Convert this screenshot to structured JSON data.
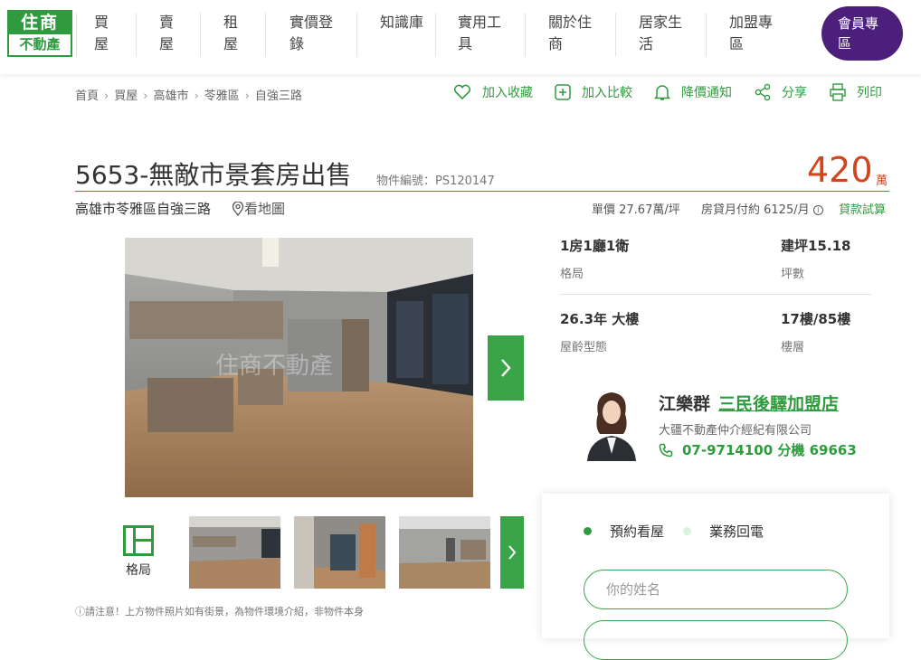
{
  "brand": {
    "logo_top": "住商",
    "logo_bottom": "不動產",
    "color": "#2f9b3e"
  },
  "nav": {
    "items": [
      "買屋",
      "賣屋",
      "租屋",
      "實價登錄",
      "知識庫",
      "實用工具",
      "關於住商",
      "居家生活",
      "加盟專區"
    ],
    "member": "會員專區"
  },
  "breadcrumb": [
    "首頁",
    "買屋",
    "高雄市",
    "苓雅區",
    "自強三路"
  ],
  "actions": {
    "favorite": "加入收藏",
    "compare": "加入比較",
    "notify": "降價通知",
    "share": "分享",
    "print": "列印"
  },
  "listing": {
    "title": "5653-無敵市景套房出售",
    "object_no": "物件編號：PS120147",
    "price": "420",
    "price_unit": "萬",
    "address": "高雄市苓雅區自強三路",
    "map_link": "看地圖",
    "unit_price": "單價  27.67萬/坪",
    "monthly_payment": "房貸月付約  6125/月",
    "loan_link": "貸款試算"
  },
  "specs": [
    {
      "value": "1房1廳1衛",
      "label": "格局"
    },
    {
      "value": "建坪15.18",
      "label": "坪數"
    },
    {
      "value": "26.3年 大樓",
      "label": "屋齡型態"
    },
    {
      "value": "17樓/85樓",
      "label": "樓層"
    }
  ],
  "gallery": {
    "layout_label": "格局",
    "notice": "ⓘ請注意！上方物件照片如有街景，為物件環境介紹，非物件本身"
  },
  "agent": {
    "name": "江樂群",
    "store": "三民後驛加盟店",
    "company": "大疆不動產仲介經紀有限公司",
    "phone": "07-9714100 分機 69663"
  },
  "contact_form": {
    "option1": "預約看屋",
    "option2": "業務回電",
    "name_placeholder": "你的姓名"
  },
  "colors": {
    "accent": "#2f9b3e",
    "price": "#d2441c",
    "member": "#4b1f7a"
  }
}
